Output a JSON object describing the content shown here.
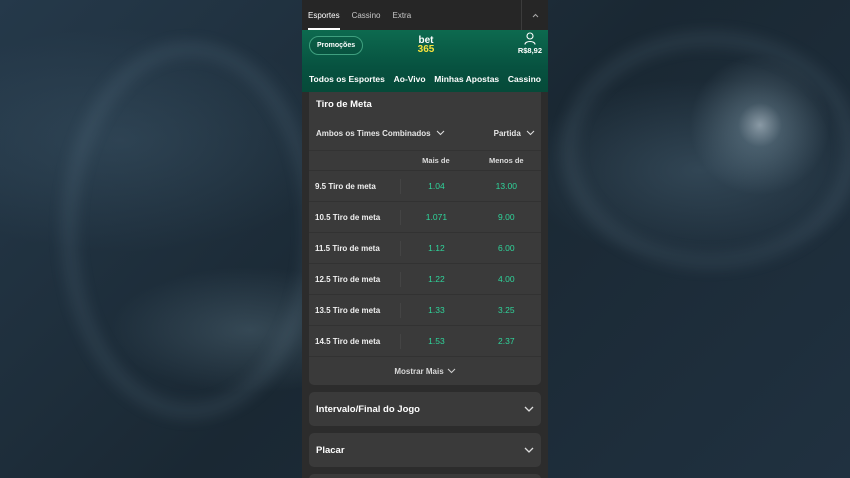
{
  "top_tabs": [
    "Esportes",
    "Cassino",
    "Extra"
  ],
  "header": {
    "promo_label": "Promoções",
    "logo_line1": "bet",
    "logo_line2": "365",
    "balance": "R$8,92"
  },
  "nav": [
    "Todos os Esportes",
    "Ao-Vivo",
    "Minhas Apostas",
    "Cassino"
  ],
  "market": {
    "title": "Tiro de Meta",
    "filter_left": "Ambos os Times Combinados",
    "filter_right": "Partida",
    "col_over": "Mais de",
    "col_under": "Menos de",
    "rows": [
      {
        "label": "9.5 Tiro de meta",
        "over": "1.04",
        "under": "13.00"
      },
      {
        "label": "10.5 Tiro de meta",
        "over": "1.071",
        "under": "9.00"
      },
      {
        "label": "11.5 Tiro de meta",
        "over": "1.12",
        "under": "6.00"
      },
      {
        "label": "12.5 Tiro de meta",
        "over": "1.22",
        "under": "4.00"
      },
      {
        "label": "13.5 Tiro de meta",
        "over": "1.33",
        "under": "3.25"
      },
      {
        "label": "14.5 Tiro de meta",
        "over": "1.53",
        "under": "2.37"
      }
    ],
    "show_more": "Mostrar Mais"
  },
  "panels": [
    "Intervalo/Final do Jogo",
    "Placar"
  ],
  "colors": {
    "accent_green": "#2fd59b",
    "header_green": "#075240",
    "logo_yellow": "#f7e23b"
  }
}
